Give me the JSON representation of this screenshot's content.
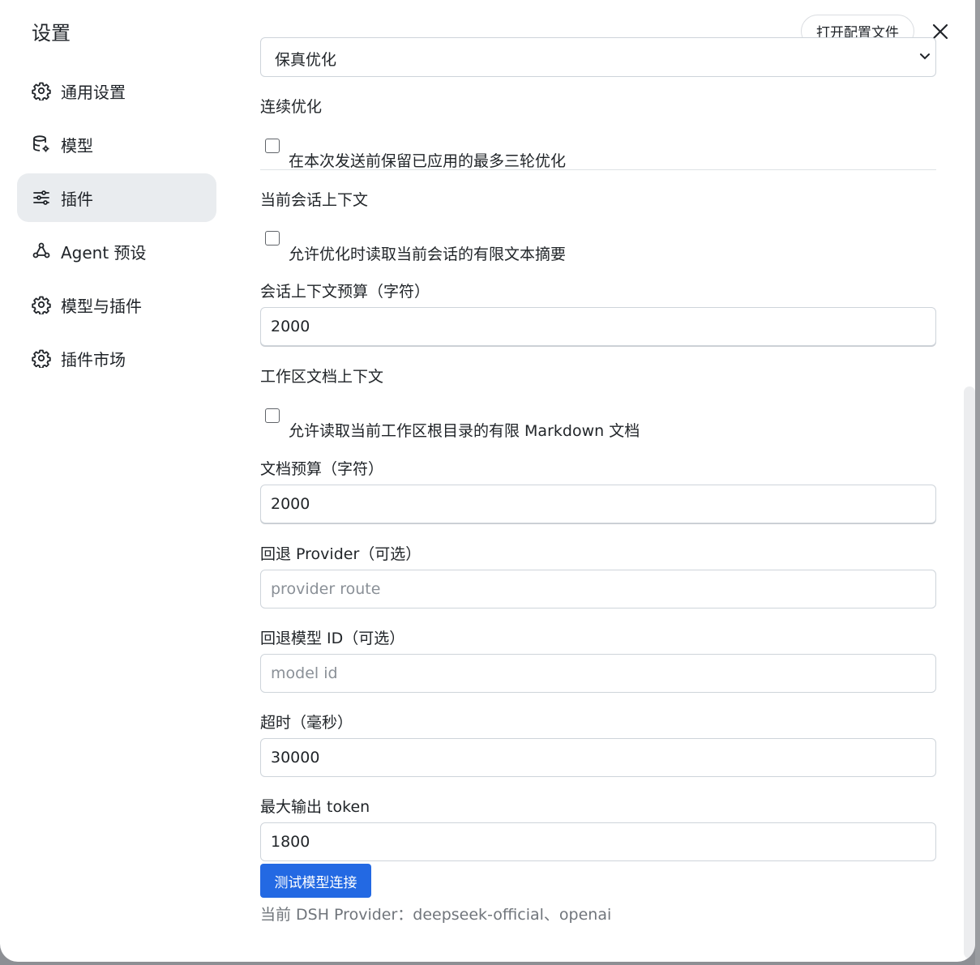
{
  "dialog": {
    "title": "设置",
    "open_config_label": "打开配置文件"
  },
  "sidebar": {
    "items": [
      {
        "label": "通用设置",
        "icon": "gear-icon",
        "active": false
      },
      {
        "label": "模型",
        "icon": "database-gear-icon",
        "active": false
      },
      {
        "label": "插件",
        "icon": "sliders-icon",
        "active": true
      },
      {
        "label": "Agent 预设",
        "icon": "agent-nodes-icon",
        "active": false
      },
      {
        "label": "模型与插件",
        "icon": "gear-icon",
        "active": false
      },
      {
        "label": "插件市场",
        "icon": "gear-icon",
        "active": false
      }
    ]
  },
  "form": {
    "strategy_select_value": "保真优化",
    "continuous": {
      "label": "连续优化",
      "checkbox_text": "在本次发送前保留已应用的最多三轮优化",
      "checked": false
    },
    "session_context": {
      "label": "当前会话上下文",
      "checkbox_text": "允许优化时读取当前会话的有限文本摘要",
      "checked": false
    },
    "session_budget": {
      "label": "会话上下文预算（字符）",
      "value": "2000"
    },
    "workspace_context": {
      "label": "工作区文档上下文",
      "checkbox_text": "允许读取当前工作区根目录的有限 Markdown 文档",
      "checked": false
    },
    "doc_budget": {
      "label": "文档预算（字符）",
      "value": "2000"
    },
    "fallback_provider": {
      "label": "回退 Provider（可选）",
      "placeholder": "provider route",
      "value": ""
    },
    "fallback_model": {
      "label": "回退模型 ID（可选）",
      "placeholder": "model id",
      "value": ""
    },
    "timeout": {
      "label": "超时（毫秒）",
      "value": "30000"
    },
    "max_tokens": {
      "label": "最大输出 token",
      "value": "1800"
    },
    "test_button_label": "测试模型连接",
    "provider_note": "当前 DSH Provider：deepseek-official、openai"
  },
  "colors": {
    "primary_button": "#2369e3",
    "active_nav_bg": "#e9ecef",
    "muted_text": "#70757b"
  }
}
